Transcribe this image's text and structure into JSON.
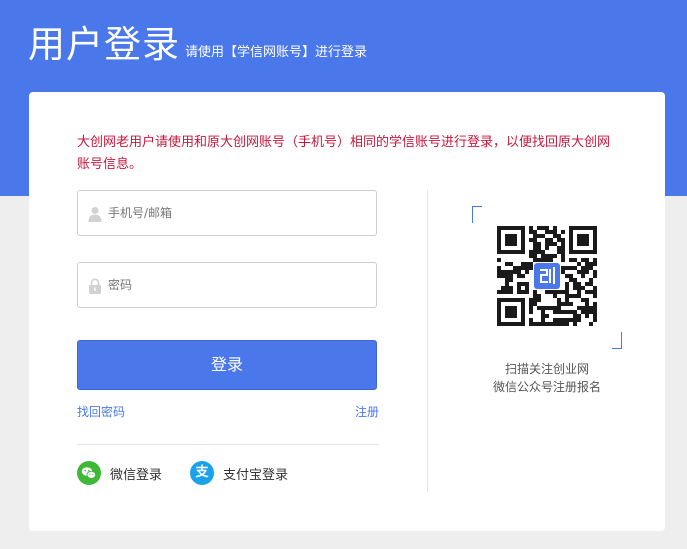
{
  "header": {
    "title": "用户登录",
    "subtitle": "请使用【学信网账号】进行登录"
  },
  "notice": "大创网老用户请使用和原大创网账号（手机号）相同的学信账号进行登录，以便找回原大创网账号信息。",
  "form": {
    "username": {
      "placeholder": "手机号/邮箱",
      "value": "",
      "icon": "user-icon"
    },
    "password": {
      "placeholder": "密码",
      "value": "",
      "icon": "lock-icon"
    },
    "login_label": "登录",
    "forgot_label": "找回密码",
    "register_label": "注册"
  },
  "social": {
    "wechat_label": "微信登录",
    "alipay_label": "支付宝登录",
    "alipay_glyph": "支"
  },
  "qr": {
    "caption_line1": "扫描关注创业网",
    "caption_line2": "微信公众号注册报名"
  },
  "colors": {
    "accent": "#4a78ea",
    "notice": "#c7173b",
    "wechat": "#3fb838",
    "alipay": "#1aa3e8"
  }
}
